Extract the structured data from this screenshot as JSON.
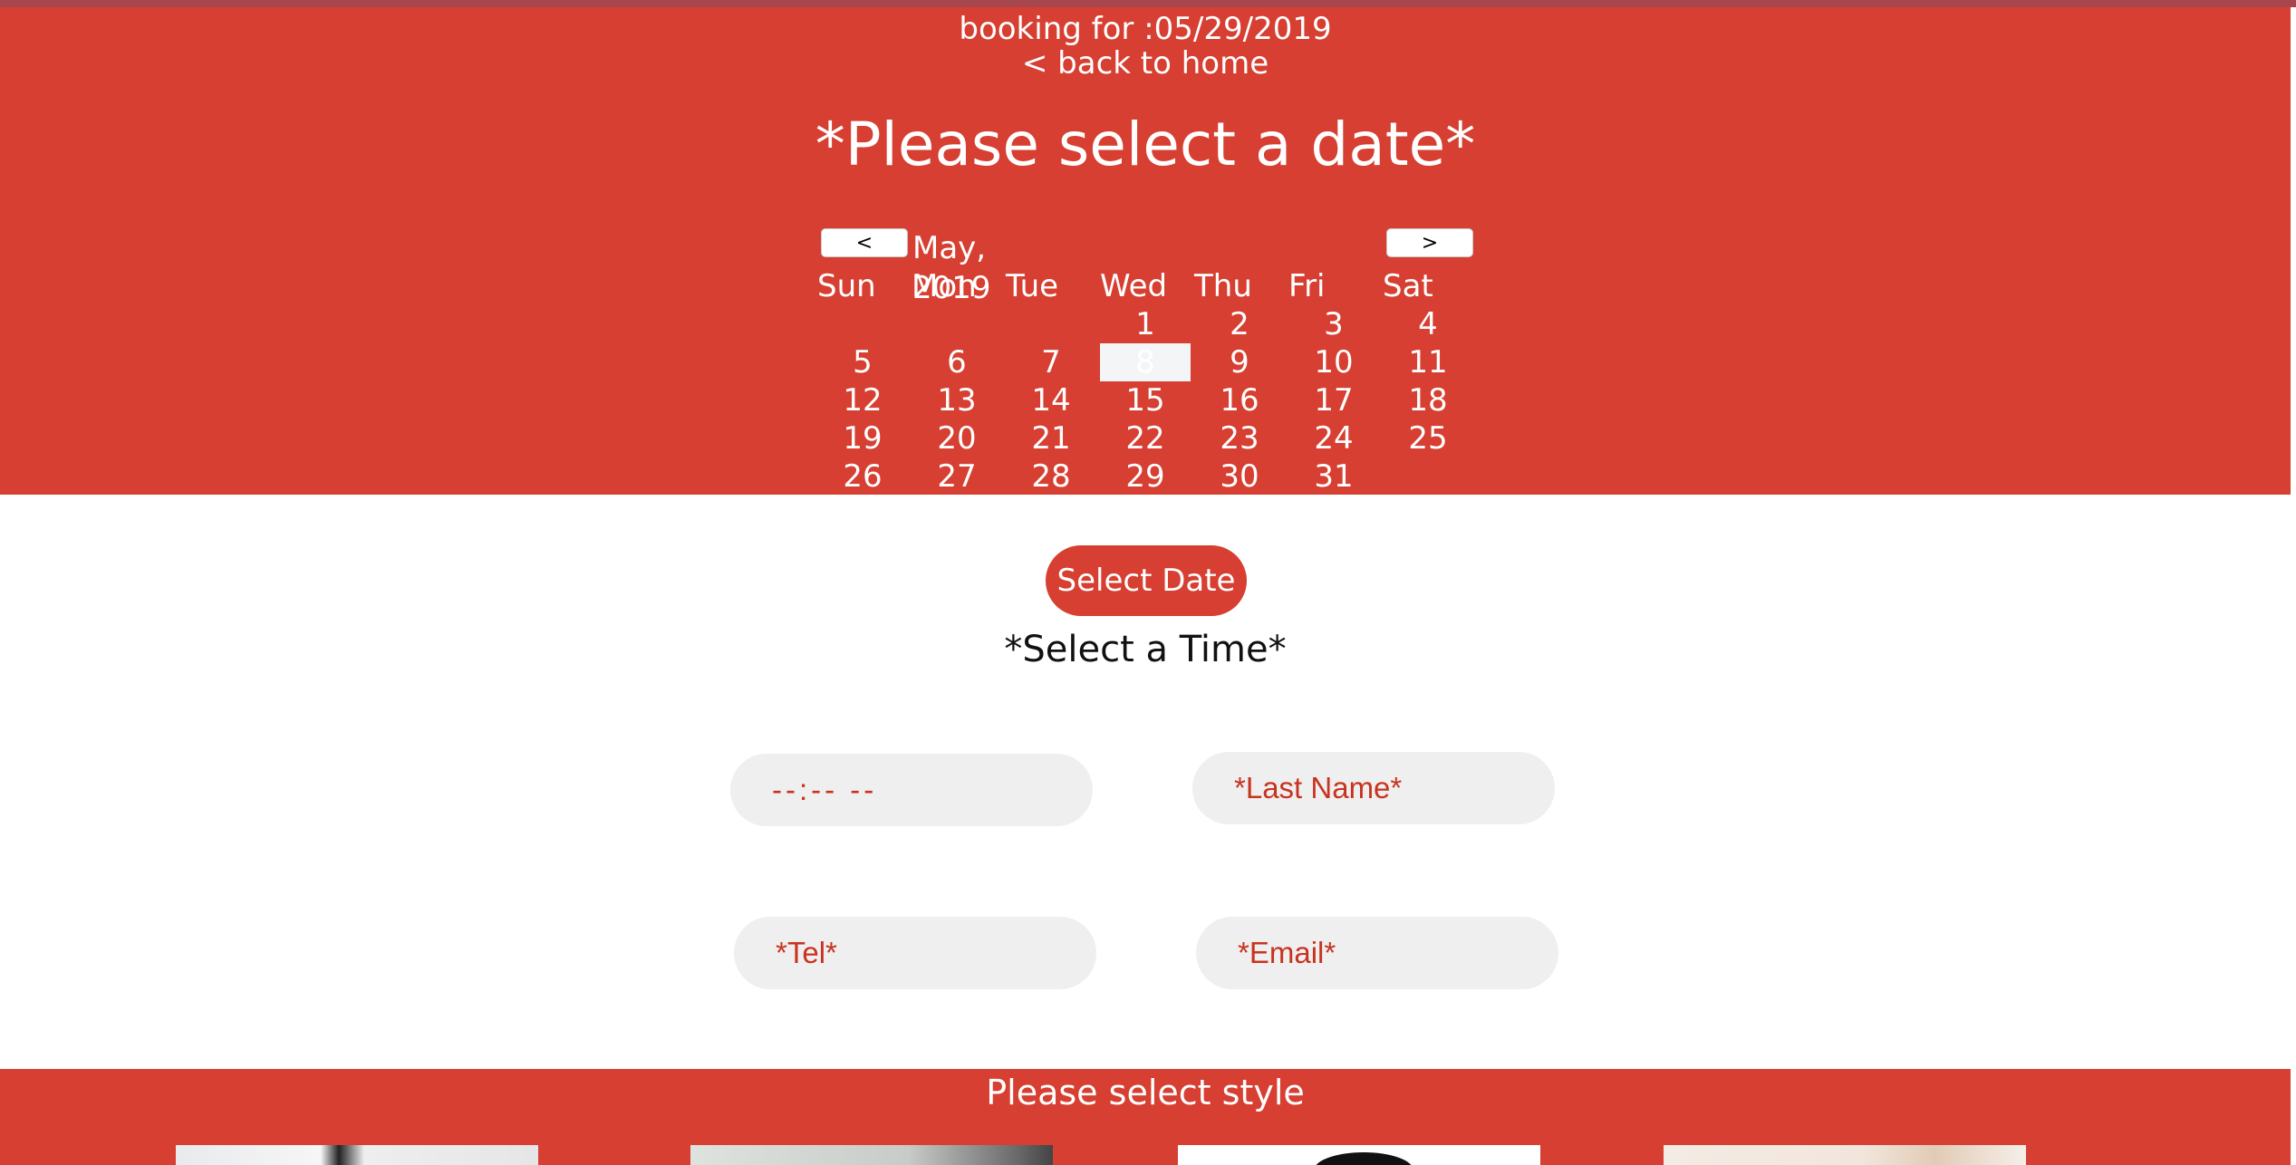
{
  "header": {
    "booking_label": "booking for :05/29/2019",
    "back_link": "< back to home",
    "title": "*Please select a date*"
  },
  "calendar": {
    "prev_label": "<",
    "next_label": ">",
    "month_label": "May, 2019",
    "weekdays": [
      "Sun",
      "Mon",
      "Tue",
      "Wed",
      "Thu",
      "Fri",
      "Sat"
    ],
    "weeks": [
      [
        "",
        "",
        "",
        "1",
        "2",
        "3",
        "4"
      ],
      [
        "5",
        "6",
        "7",
        "8",
        "9",
        "10",
        "11"
      ],
      [
        "12",
        "13",
        "14",
        "15",
        "16",
        "17",
        "18"
      ],
      [
        "19",
        "20",
        "21",
        "22",
        "23",
        "24",
        "25"
      ],
      [
        "26",
        "27",
        "28",
        "29",
        "30",
        "31",
        ""
      ]
    ],
    "selected_day": "8"
  },
  "form": {
    "select_date_label": "Select Date",
    "select_time_heading": "*Select a Time*",
    "time_value": "--:-- --",
    "last_name_placeholder": "*Last Name*",
    "tel_placeholder": "*Tel*",
    "email_placeholder": "*Email*"
  },
  "style_section": {
    "heading": "Please select style"
  },
  "colors": {
    "accent": "#d63f31",
    "field_bg": "#efefef",
    "field_text": "#c8331f"
  }
}
